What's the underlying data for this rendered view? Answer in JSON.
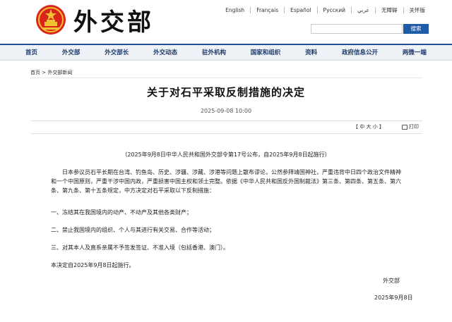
{
  "header": {
    "logo_text": "外交部",
    "languages": [
      "English",
      "Français",
      "Español",
      "Русский",
      "عربي",
      "无障碍",
      "关怀版"
    ],
    "search_button": "搜索"
  },
  "nav": {
    "items": [
      "首页",
      "外交部",
      "外交部长",
      "外交动态",
      "驻外机构",
      "国家和组织",
      "资料",
      "政府信息公开",
      "两微一端"
    ]
  },
  "breadcrumb": "首页 > 外交部新闻",
  "article": {
    "title": "关于对石平采取反制措施的决定",
    "date": "2025-09-08 10:00",
    "font_size_tools": "【 中  大  小 】",
    "print_label": "打印",
    "subtitle": "（2025年9月8日中华人民共和国外交部令第17号公布，自2025年9月8日起施行）",
    "paragraphs": [
      "日本参议员石平长期在台湾、钓鱼岛、历史、涉疆、涉藏、涉港等问题上散布谬论，公然参拜靖国神社，严重违背中日四个政治文件精神和一个中国原则，严重干涉中国内政，严重损害中国主权和领土完整。依据《中华人民共和国反外国制裁法》第三条、第四条、第五条、第六条、第九条、第十五条规定，中方决定对石平采取以下反制措施：",
      "一、冻结其在我国境内的动产、不动产及其他各类财产；",
      "二、禁止我国境内的组织、个人与其进行有关交易、合作等活动；",
      "三、对其本人及直系亲属不予签发签证、不准入境（包括香港、澳门）。",
      "本决定自2025年9月8日起施行。"
    ],
    "signature_org": "外交部",
    "signature_date": "2025年9月8日"
  },
  "colors": {
    "nav_accent": "#1f4f96",
    "search_button_bg": "#1f5ca8",
    "emblem_red": "#d9261c",
    "emblem_gold": "#f2c230"
  }
}
